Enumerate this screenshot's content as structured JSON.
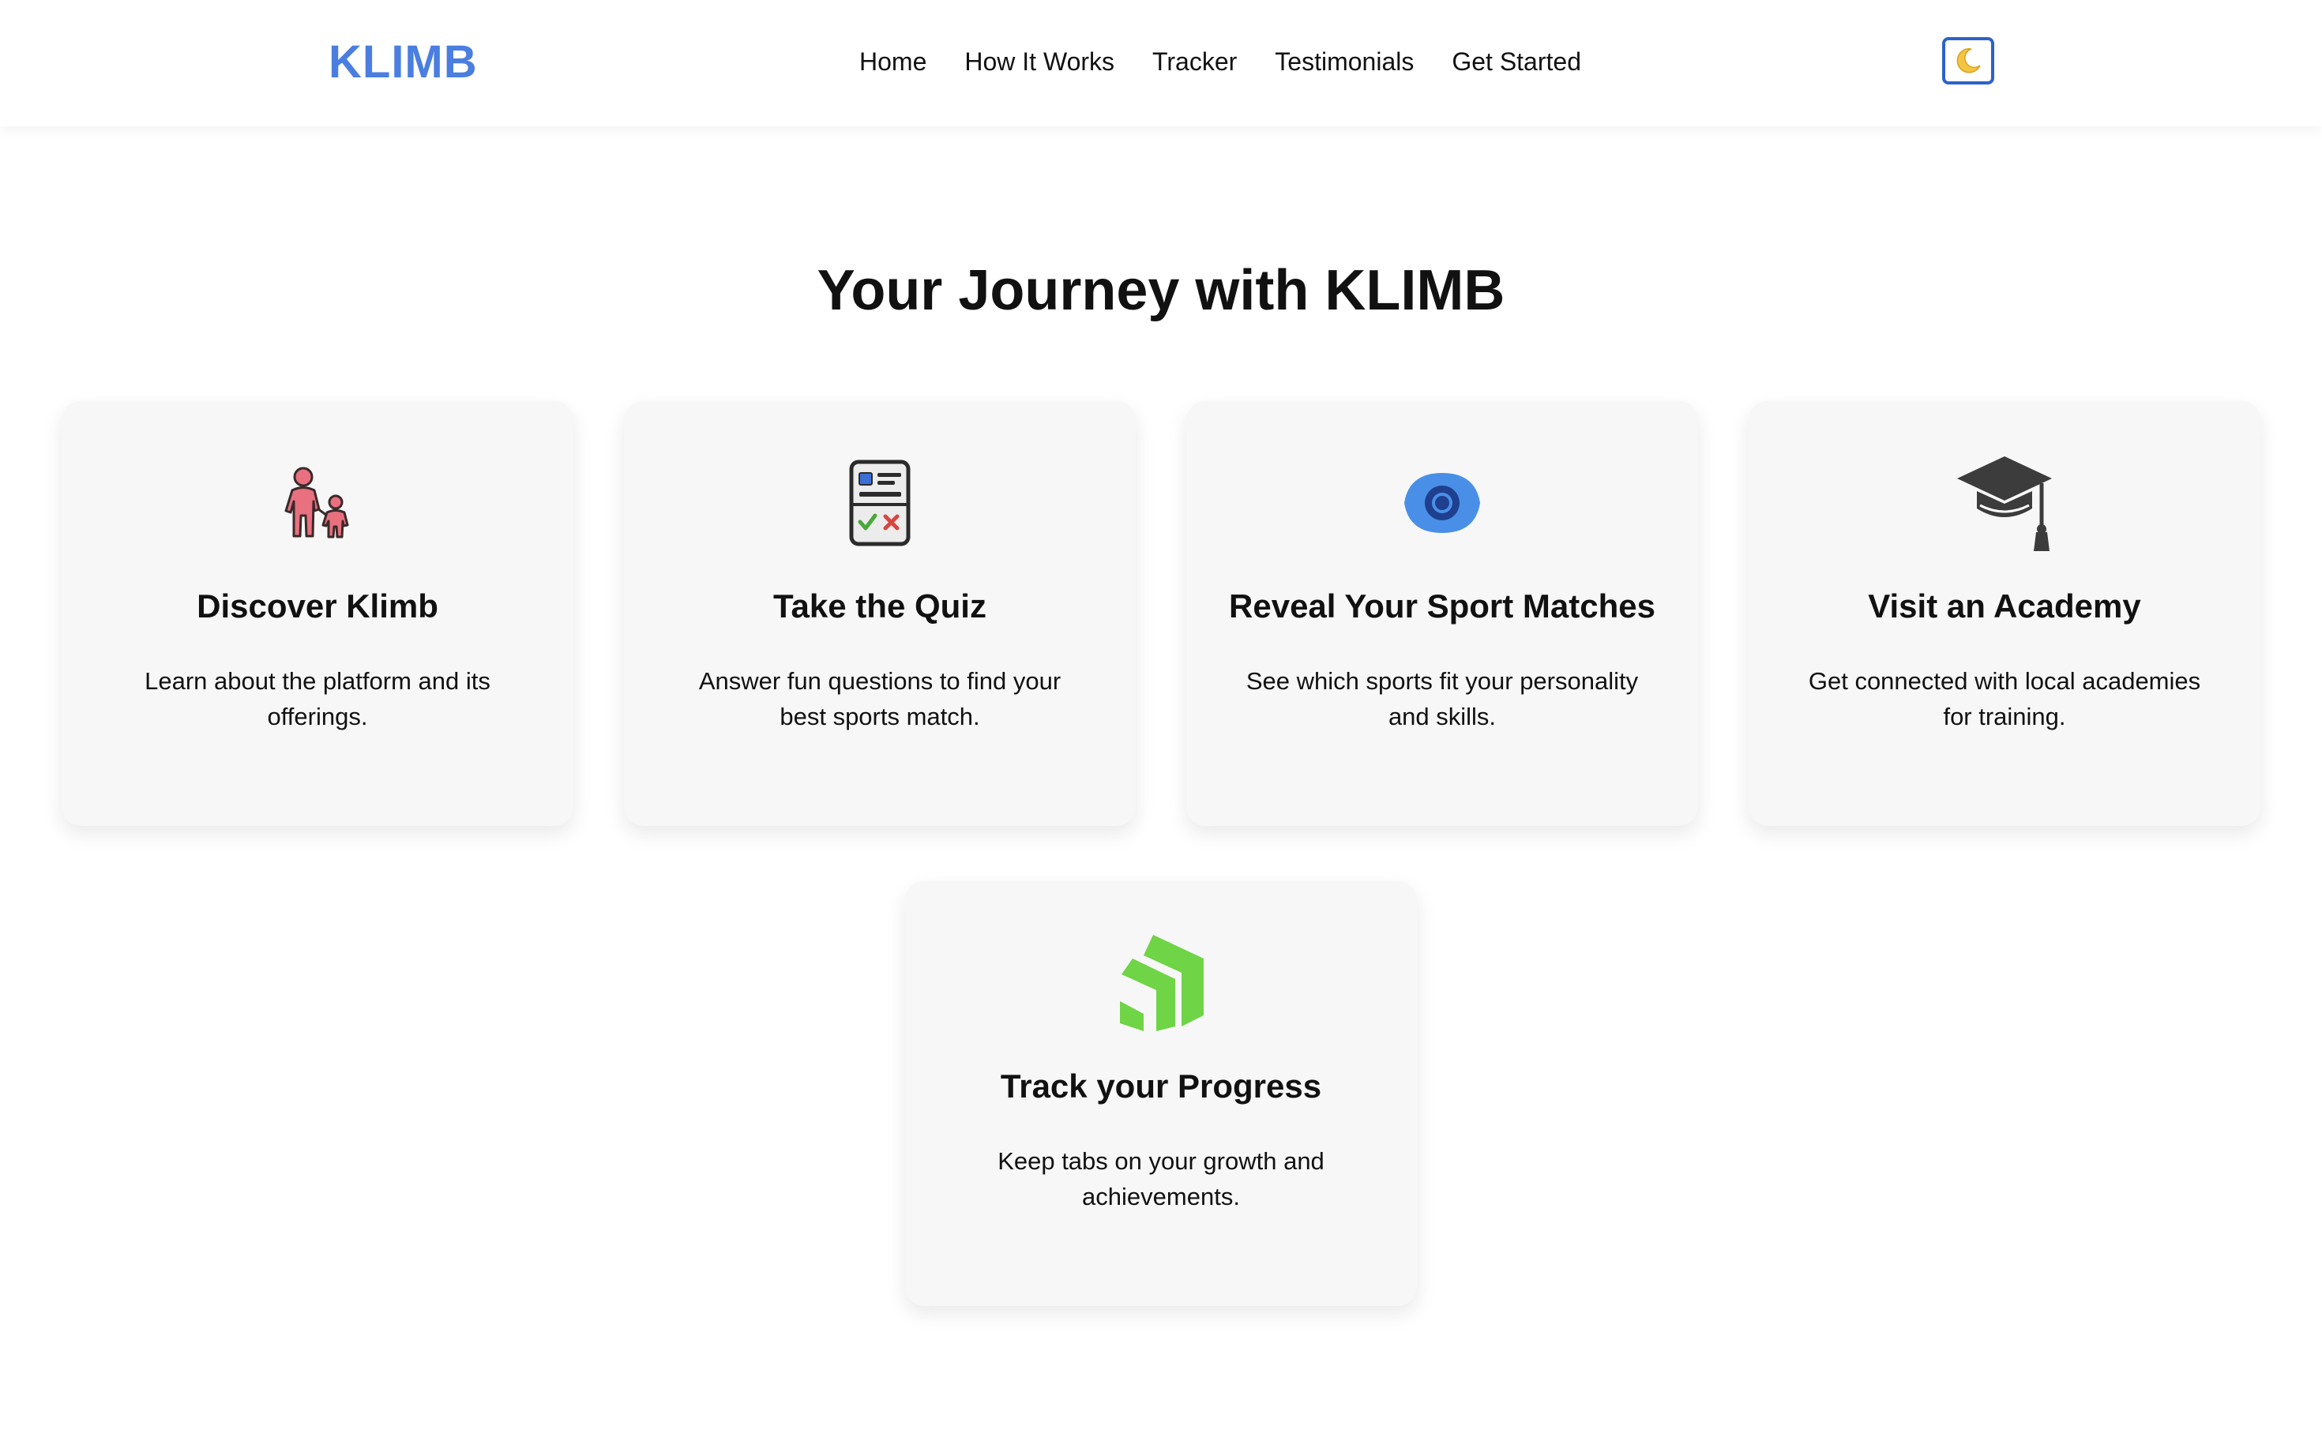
{
  "brand": {
    "logo": "KLIMB"
  },
  "nav": {
    "items": [
      {
        "label": "Home"
      },
      {
        "label": "How It Works"
      },
      {
        "label": "Tracker"
      },
      {
        "label": "Testimonials"
      },
      {
        "label": "Get Started"
      }
    ],
    "theme_toggle_icon": "moon-icon",
    "theme_toggle_glyph": "🌙"
  },
  "journey": {
    "title": "Your Journey with KLIMB",
    "steps": [
      {
        "icon": "parent-child-icon",
        "title": "Discover Klimb",
        "description": "Learn about the platform and its offerings."
      },
      {
        "icon": "quiz-form-icon",
        "title": "Take the Quiz",
        "description": "Answer fun questions to find your best sports match."
      },
      {
        "icon": "eye-icon",
        "title": "Reveal Your Sport Matches",
        "description": "See which sports fit your personality and skills."
      },
      {
        "icon": "graduation-cap-icon",
        "title": "Visit an Academy",
        "description": "Get connected with local academies for training."
      },
      {
        "icon": "progress-arrows-icon",
        "title": "Track your Progress",
        "description": "Keep tabs on your growth and achievements."
      }
    ]
  },
  "colors": {
    "brand_blue": "#4a7ee0",
    "toggle_border": "#2d62c9",
    "card_bg": "#f7f7f7",
    "icon_pink": "#e8707f",
    "icon_blue": "#4a8fe7",
    "icon_dark": "#3c3c3c",
    "icon_green": "#6fd446"
  }
}
